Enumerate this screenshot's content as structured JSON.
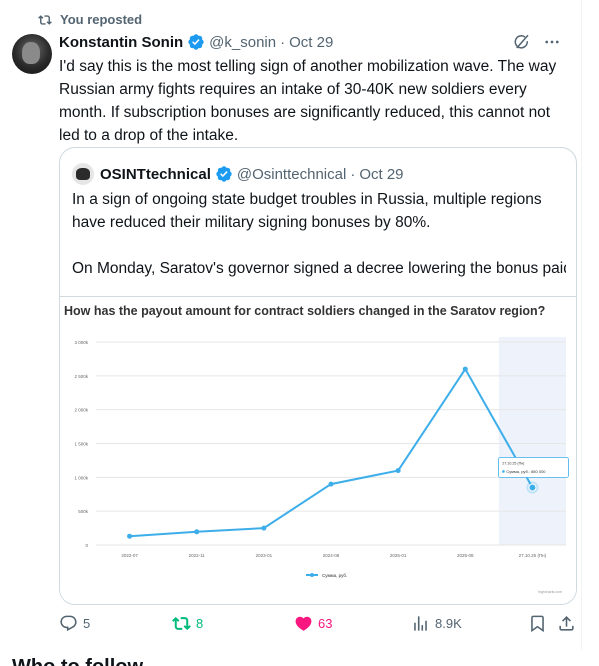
{
  "repost": {
    "label": "You reposted"
  },
  "tweet": {
    "author_name": "Konstantin Sonin",
    "handle": "@k_sonin",
    "date": "Oct 29",
    "separator": "·",
    "text": "I'd say this is the most telling sign of another mobilization wave. The way Russian army fights requires an intake of 30-40K new soldiers every month. If subscription bonuses are significantly reduced, this cannot not led to a drop of the intake."
  },
  "quote": {
    "author_name": "OSINTtechnical",
    "handle": "@Osinttechnical",
    "date": "Oct 29",
    "separator": "·",
    "paragraph1": "In a sign of ongoing state budget troubles in Russia, multiple regions have reduced their military signing bonuses by 80%.",
    "paragraph2": "On Monday, Saratov's governor signed a decree lowering the bonus paid to those who sign up to fight in Ukraine from 2.2 million Rubles to..."
  },
  "chart_data": {
    "type": "line",
    "title": "How has the payout amount for contract soldiers changed in the Saratov region?",
    "categories": [
      "2022-07",
      "2022-11",
      "2023-01",
      "2024-08",
      "2025-01",
      "2025-08",
      "27.10.25 (Пн)"
    ],
    "series": [
      {
        "name": "Сумма, руб.",
        "values": [
          130000,
          195000,
          250000,
          900000,
          1100000,
          2600000,
          850000
        ]
      }
    ],
    "y_ticks": [
      "0",
      "500k",
      "1 000k",
      "1 500k",
      "2 000k",
      "2 500k",
      "3 000k"
    ],
    "ylim": [
      0,
      3000000
    ],
    "tooltip": {
      "date": "27.10.25 (Пн)",
      "label": "Сумма, руб.",
      "value": "850 000"
    },
    "credit": "highcharts.com",
    "highlight_last": true,
    "color": "#3daee9",
    "legend_position": "bottom-center",
    "grid": true
  },
  "actions": {
    "replies": "5",
    "reposts": "8",
    "likes": "63",
    "views": "8.9K"
  },
  "next_section": {
    "title": "Who to follow"
  },
  "colors": {
    "accent": "#1d9bf0",
    "repost": "#00ba7c",
    "like": "#f91880",
    "muted": "#536471"
  }
}
